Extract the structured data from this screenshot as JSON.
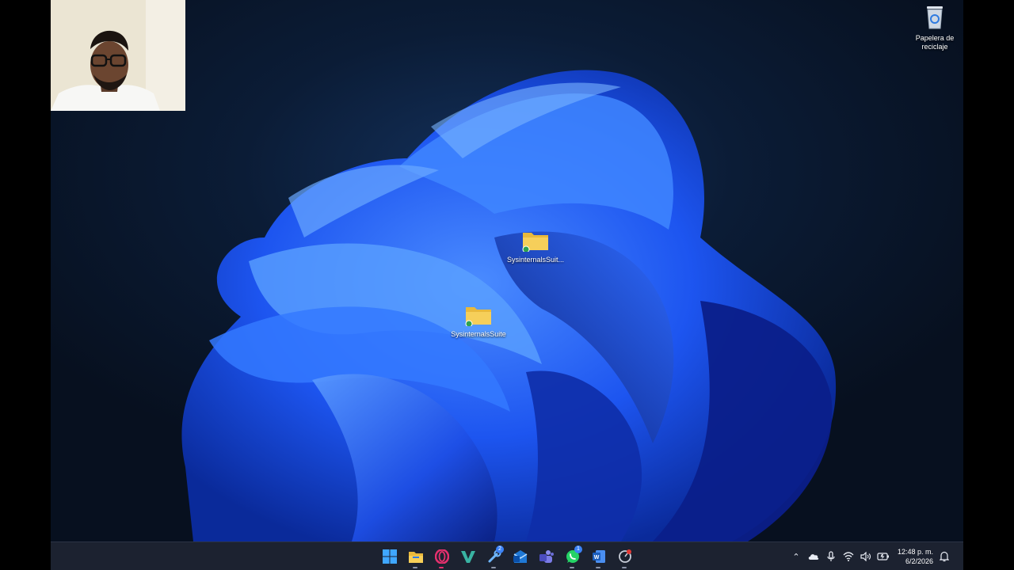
{
  "desktop": {
    "icons": [
      {
        "label": "Papelera de reciclaje",
        "icon": "recycle-bin-icon"
      },
      {
        "label": "SysinternalsSuit...",
        "icon": "folder-icon"
      },
      {
        "label": "SysinternalsSuite",
        "icon": "folder-icon"
      }
    ]
  },
  "taskbar": {
    "apps": [
      {
        "name": "start-icon"
      },
      {
        "name": "file-explorer-icon"
      },
      {
        "name": "opera-icon"
      },
      {
        "name": "visual-studio-icon"
      },
      {
        "name": "steam-icon",
        "badge": "2"
      },
      {
        "name": "outlook-icon"
      },
      {
        "name": "teams-icon"
      },
      {
        "name": "whatsapp-icon",
        "badge": "1"
      },
      {
        "name": "word-icon"
      },
      {
        "name": "recorder-icon"
      }
    ],
    "tray": {
      "clock_time": "12:48 p. m.",
      "clock_date": "6/2/2026"
    }
  },
  "colors": {
    "taskbar_bg": "#1c2230",
    "wallpaper_blue": "#1a4ee8"
  }
}
